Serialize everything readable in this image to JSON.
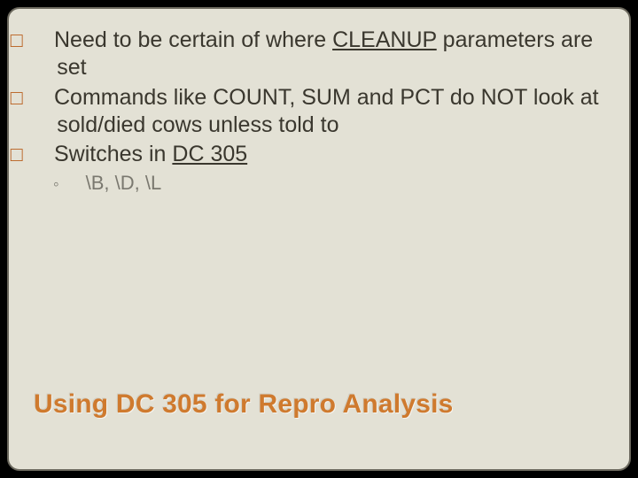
{
  "bullets": [
    {
      "marker": "□",
      "parts": [
        {
          "text": "Need to be certain of where "
        },
        {
          "text": "CLEANUP",
          "underline": true
        },
        {
          "text": " parameters are set"
        }
      ]
    },
    {
      "marker": "□",
      "parts": [
        {
          "text": "Commands like COUNT, SUM and PCT do NOT look at sold/died cows unless told to"
        }
      ]
    },
    {
      "marker": "□",
      "parts": [
        {
          "text": "Switches in "
        },
        {
          "text": "DC 305",
          "underline": true
        }
      ]
    }
  ],
  "sub_bullet": {
    "marker": "◦",
    "text": "\\B, \\D, \\L"
  },
  "title": "Using DC 305 for Repro Analysis"
}
